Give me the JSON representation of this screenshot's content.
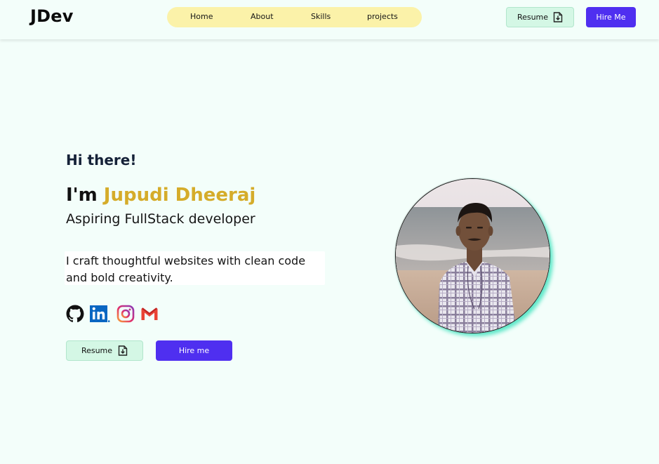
{
  "header": {
    "logo": "JDev",
    "nav": [
      "Home",
      "About",
      "Skills",
      "projects"
    ],
    "resume_label": "Resume",
    "hire_label": "Hire Me"
  },
  "hero": {
    "greeting": "Hi there!",
    "intro_prefix": "I'm ",
    "name": "Jupudi Dheeraj",
    "role": "Aspiring FullStack developer",
    "description": "I craft thoughtful websites with clean code and bold creativity.",
    "resume_label": "Resume",
    "hire_label": "Hire me"
  },
  "social": [
    "github-icon",
    "linkedin-icon",
    "instagram-icon",
    "gmail-icon"
  ],
  "colors": {
    "background": "#f3fefa",
    "accent_yellow": "#d5ac2a",
    "nav_pill": "#fbf2a9",
    "primary": "#4f2ff0",
    "resume_bg": "#d4f7e5",
    "photo_glow": "#5fe8c9"
  }
}
